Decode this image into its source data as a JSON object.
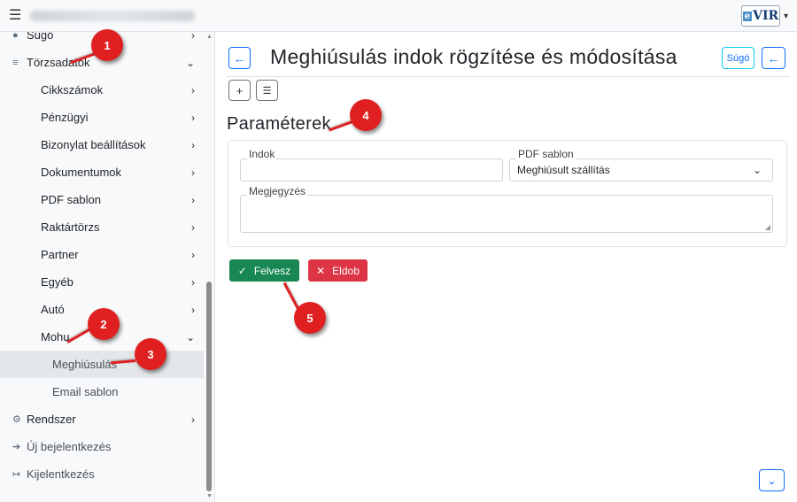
{
  "topbar": {
    "menu_icon": "hamburger-icon",
    "logo_text": "VIR",
    "logo_badge": "e"
  },
  "sidebar": {
    "items": [
      {
        "label": "Súgó",
        "icon": "help-icon",
        "chevron": "›"
      },
      {
        "label": "Törzsadatok",
        "icon": "database-icon",
        "chevron": "⌄"
      },
      {
        "label": "Cikkszámok",
        "chevron": "›"
      },
      {
        "label": "Pénzügyi",
        "chevron": "›"
      },
      {
        "label": "Bizonylat beállítások",
        "chevron": "›"
      },
      {
        "label": "Dokumentumok",
        "chevron": "›"
      },
      {
        "label": "PDF sablon",
        "chevron": "›"
      },
      {
        "label": "Raktártörzs",
        "chevron": "›"
      },
      {
        "label": "Partner",
        "chevron": "›"
      },
      {
        "label": "Egyéb",
        "chevron": "›"
      },
      {
        "label": "Autó",
        "chevron": "›"
      },
      {
        "label": "Mohu",
        "chevron": "⌄"
      },
      {
        "label": "Meghiúsulás"
      },
      {
        "label": "Email sablon"
      },
      {
        "label": "Rendszer",
        "icon": "gears-icon",
        "chevron": "›"
      },
      {
        "label": "Új bejelentkezés",
        "icon": "login-icon"
      },
      {
        "label": "Kijelentkezés",
        "icon": "logout-icon"
      }
    ]
  },
  "main": {
    "title": "Meghiúsulás indok rögzítése és módosítása",
    "help_button": "Súgó",
    "section_title": "Paraméterek",
    "fields": {
      "indok_label": "Indok",
      "indok_value": "",
      "pdf_label": "PDF sablon",
      "pdf_value": "Meghiúsult szállítás",
      "megjegyzes_label": "Megjegyzés",
      "megjegyzes_value": ""
    },
    "save_button": "Felvesz",
    "cancel_button": "Eldob"
  },
  "markers": [
    "1",
    "2",
    "3",
    "4",
    "5"
  ],
  "colors": {
    "primary": "#0d6efd",
    "success": "#198754",
    "danger": "#dc3545",
    "marker": "#e02020"
  }
}
